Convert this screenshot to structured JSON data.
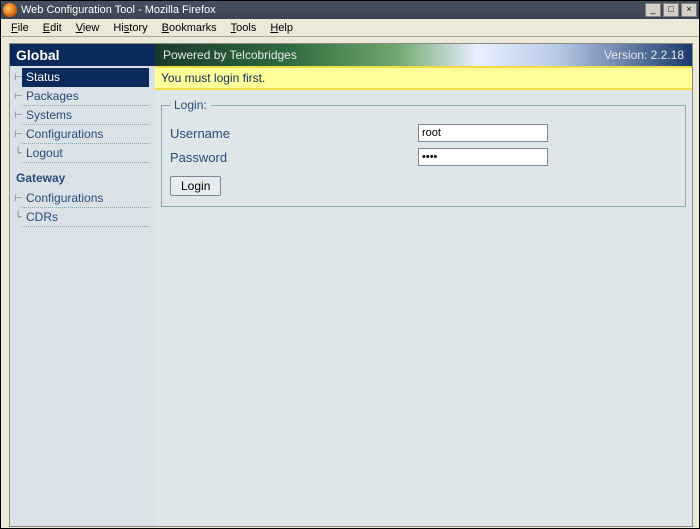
{
  "window": {
    "title": "Web Configuration Tool - Mozilla Firefox",
    "min": "_",
    "max": "□",
    "close": "×"
  },
  "menu": {
    "file": "File",
    "edit": "Edit",
    "view": "View",
    "history": "History",
    "bookmarks": "Bookmarks",
    "tools": "Tools",
    "help": "Help"
  },
  "sidebar": {
    "global_header": "Global",
    "gateway_header": "Gateway",
    "global_items": [
      {
        "label": "Status",
        "active": true
      },
      {
        "label": "Packages"
      },
      {
        "label": "Systems"
      },
      {
        "label": "Configurations"
      },
      {
        "label": "Logout"
      }
    ],
    "gateway_items": [
      {
        "label": "Configurations"
      },
      {
        "label": "CDRs"
      }
    ]
  },
  "banner": {
    "brand": "Powered by Telcobridges",
    "version": "Version: 2.2.18"
  },
  "alert": "You must login first.",
  "login": {
    "legend": "Login:",
    "username_label": "Username",
    "password_label": "Password",
    "username_value": "root",
    "password_value": "****",
    "button": "Login"
  }
}
